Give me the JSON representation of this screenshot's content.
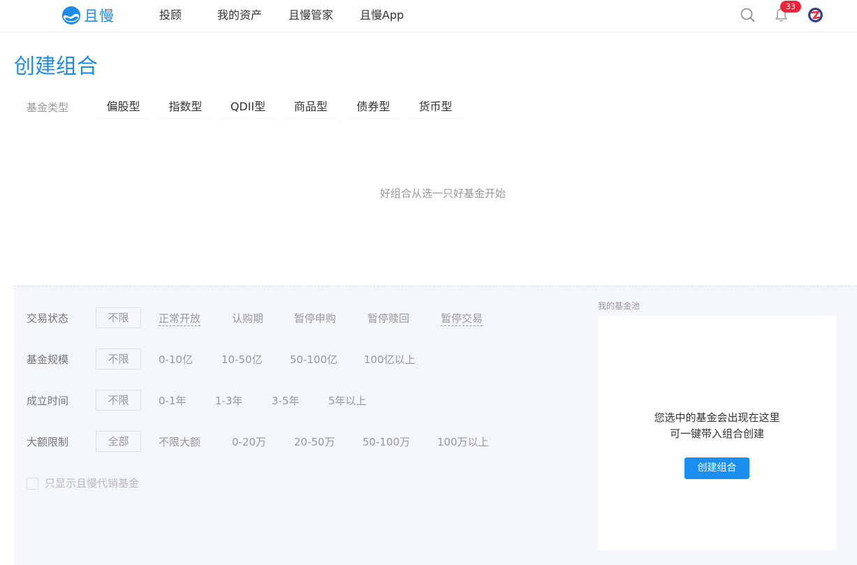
{
  "header": {
    "logo_text": "且慢",
    "nav": [
      "投顾",
      "我的资产",
      "且慢管家",
      "且慢App"
    ],
    "notification_count": "33",
    "colors": {
      "brand": "#1b8de8",
      "badge": "#f0223c"
    },
    "icons": {
      "search": "search-icon",
      "bell": "bell-icon",
      "avatar": "avatar"
    }
  },
  "page": {
    "title": "创建组合",
    "type_label": "基金类型",
    "types": [
      "偏股型",
      "指数型",
      "QDII型",
      "商品型",
      "债券型",
      "货币型"
    ],
    "empty_hint": "好组合从选一只好基金开始"
  },
  "filters": {
    "rows": [
      {
        "label": "交易状态",
        "selected": "不限",
        "options": [
          "正常开放",
          "认购期",
          "暂停申购",
          "暂停赎回",
          "暂停交易"
        ]
      },
      {
        "label": "基金规模",
        "selected": "不限",
        "options": [
          "0-10亿",
          "10-50亿",
          "50-100亿",
          "100亿以上"
        ]
      },
      {
        "label": "成立时间",
        "selected": "不限",
        "options": [
          "0-1年",
          "1-3年",
          "3-5年",
          "5年以上"
        ]
      },
      {
        "label": "大额限制",
        "selected": "全部",
        "options": [
          "不限大额",
          "0-20万",
          "20-50万",
          "50-100万",
          "100万以上"
        ]
      }
    ],
    "checkbox_label": "只显示且慢代销基金",
    "checkbox_checked": false
  },
  "pool": {
    "title": "我的基金池",
    "line1": "您选中的基金会出现在这里",
    "line2": "可一键带入组合创建",
    "button": "创建组合"
  }
}
